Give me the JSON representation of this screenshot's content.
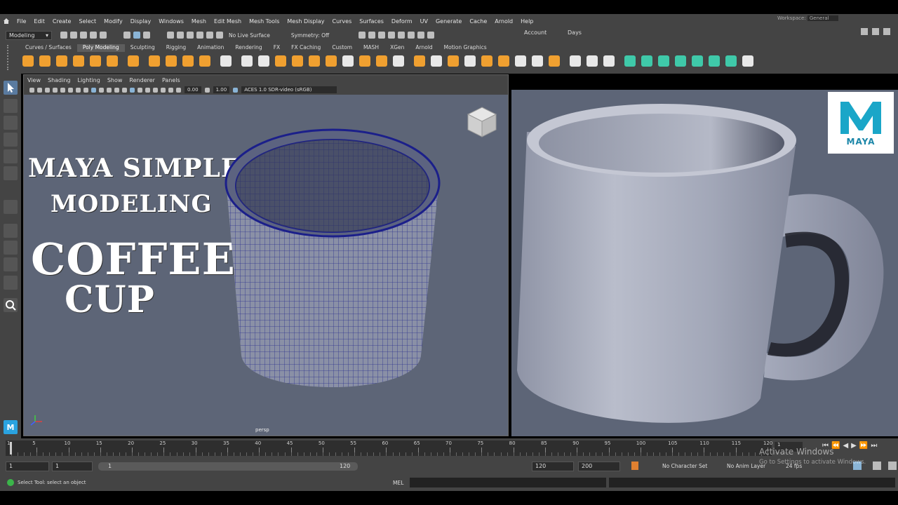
{
  "menu": [
    "File",
    "Edit",
    "Create",
    "Select",
    "Modify",
    "Display",
    "Windows",
    "Mesh",
    "Edit Mesh",
    "Mesh Tools",
    "Mesh Display",
    "Curves",
    "Surfaces",
    "Deform",
    "UV",
    "Generate",
    "Cache",
    "Arnold",
    "Help"
  ],
  "workspace": {
    "label": "Workspace:",
    "value": "General"
  },
  "status": {
    "mode": "Modeling",
    "live_surface": "No Live Surface",
    "symmetry": "Symmetry: Off",
    "account": "Account",
    "days": "Days"
  },
  "shelf_tabs": [
    "Curves / Surfaces",
    "Poly Modeling",
    "Sculpting",
    "Rigging",
    "Animation",
    "Rendering",
    "FX",
    "FX Caching",
    "Custom",
    "MASH",
    "XGen",
    "Arnold",
    "Motion Graphics"
  ],
  "shelf_active": "Poly Modeling",
  "viewport": {
    "menu": [
      "View",
      "Shading",
      "Lighting",
      "Show",
      "Renderer",
      "Panels"
    ],
    "val1": "0.00",
    "val2": "1.00",
    "colorspace": "ACES 1.0 SDR-video (sRGB)",
    "camera": "persp"
  },
  "overlay": {
    "line1": "MAYA SIMPLE",
    "line2": "MODELING",
    "line3": "COFFEE",
    "line4": "CUP"
  },
  "logo": "MAYA",
  "timeline": {
    "ticks": [
      "1",
      "5",
      "10",
      "15",
      "20",
      "25",
      "30",
      "35",
      "40",
      "45",
      "50",
      "55",
      "60",
      "65",
      "70",
      "75",
      "80",
      "85",
      "90",
      "95",
      "100",
      "105",
      "110",
      "115",
      "120"
    ],
    "current": "1"
  },
  "range": {
    "start": "1",
    "start2": "1",
    "slider_start": "1",
    "slider_end": "120",
    "end": "120",
    "end2": "200",
    "character_set": "No Character Set",
    "anim_layer": "No Anim Layer",
    "fps": "24 fps"
  },
  "watermark": {
    "line1": "Activate Windows",
    "line2": "Go to Settings to activate Windows."
  },
  "cmd": {
    "help": "Select Tool: select an object",
    "lang": "MEL"
  },
  "colors": {
    "panel": "#444444",
    "viewport": "#5d6577",
    "wire": "#1b1f8a",
    "accent": "#3fc9a9"
  }
}
